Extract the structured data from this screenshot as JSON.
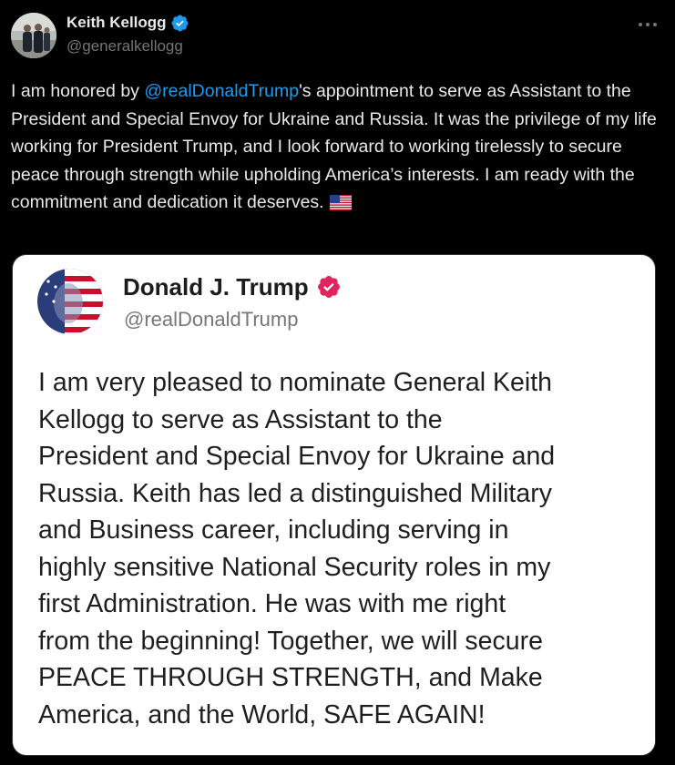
{
  "author": {
    "name": "Keith Kellogg",
    "handle": "@generalkellogg",
    "verified_color": "#1d9bf0"
  },
  "more_icon": "ellipsis-icon",
  "tweet": {
    "before_mention": "I am honored by ",
    "mention": "@realDonaldTrump",
    "after_mention": "'s appointment to serve as Assistant to the President and Special Envoy for Ukraine and Russia. It was the privilege of my life working for President Trump, and I look forward to working tirelessly to secure peace through strength while upholding America’s interests. I am ready with the commitment and dedication it deserves.",
    "emoji": "us-flag-emoji"
  },
  "embedded_post": {
    "name": "Donald J. Trump",
    "handle": "@realDonaldTrump",
    "badge_color": "#e0245e",
    "lines": [
      "I am very pleased to nominate General Keith",
      "Kellogg to serve as Assistant to the",
      "President and Special Envoy for Ukraine and",
      "Russia. Keith has led a distinguished Military",
      "and Business career, including serving in",
      "highly sensitive National Security roles in my",
      "first Administration. He was with me right",
      "from the beginning! Together, we will secure",
      "PEACE THROUGH STRENGTH, and Make",
      "America, and the World, SAFE AGAIN!"
    ]
  },
  "colors": {
    "background": "#000000",
    "text": "#e7e9ea",
    "secondary": "#71767b",
    "link": "#1d9bf0"
  }
}
